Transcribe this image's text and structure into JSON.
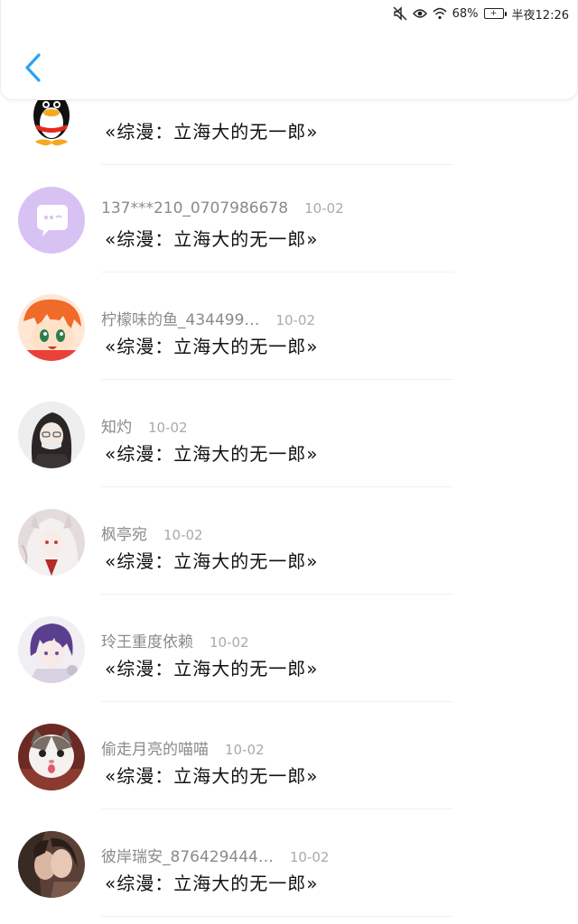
{
  "status_bar": {
    "battery_percent": "68%",
    "battery_level": "+",
    "time": "半夜12:26",
    "icons": [
      "mute-icon",
      "eye-icon",
      "wifi-icon",
      "battery-icon"
    ]
  },
  "header": {
    "back_icon": "chevron-left-icon",
    "accent_color": "#2aa3f5"
  },
  "comments": [
    {
      "avatar": "penguin-avatar",
      "username": "",
      "date": "",
      "text": "«综漫：立海大的无一郎»"
    },
    {
      "avatar": "chat-bubble-avatar",
      "username": "137***210_0707986678",
      "date": "10-02",
      "text": "«综漫：立海大的无一郎»"
    },
    {
      "avatar": "anime-avatar-orange",
      "username": "柠檬味的鱼_434499…",
      "date": "10-02",
      "text": "«综漫：立海大的无一郎»"
    },
    {
      "avatar": "anime-avatar-dark",
      "username": "知灼",
      "date": "10-02",
      "text": "«综漫：立海大的无一郎»"
    },
    {
      "avatar": "anime-avatar-white",
      "username": "枫亭宛",
      "date": "10-02",
      "text": "«综漫：立海大的无一郎»"
    },
    {
      "avatar": "anime-avatar-purple",
      "username": "玲王重度依赖",
      "date": "10-02",
      "text": "«综漫：立海大的无一郎»"
    },
    {
      "avatar": "cat-avatar",
      "username": "偷走月亮的喵喵",
      "date": "10-02",
      "text": "«综漫：立海大的无一郎»"
    },
    {
      "avatar": "anime-avatar-couple",
      "username": "彼岸瑞安_876429444…",
      "date": "10-02",
      "text": "«综漫：立海大的无一郎»"
    }
  ]
}
